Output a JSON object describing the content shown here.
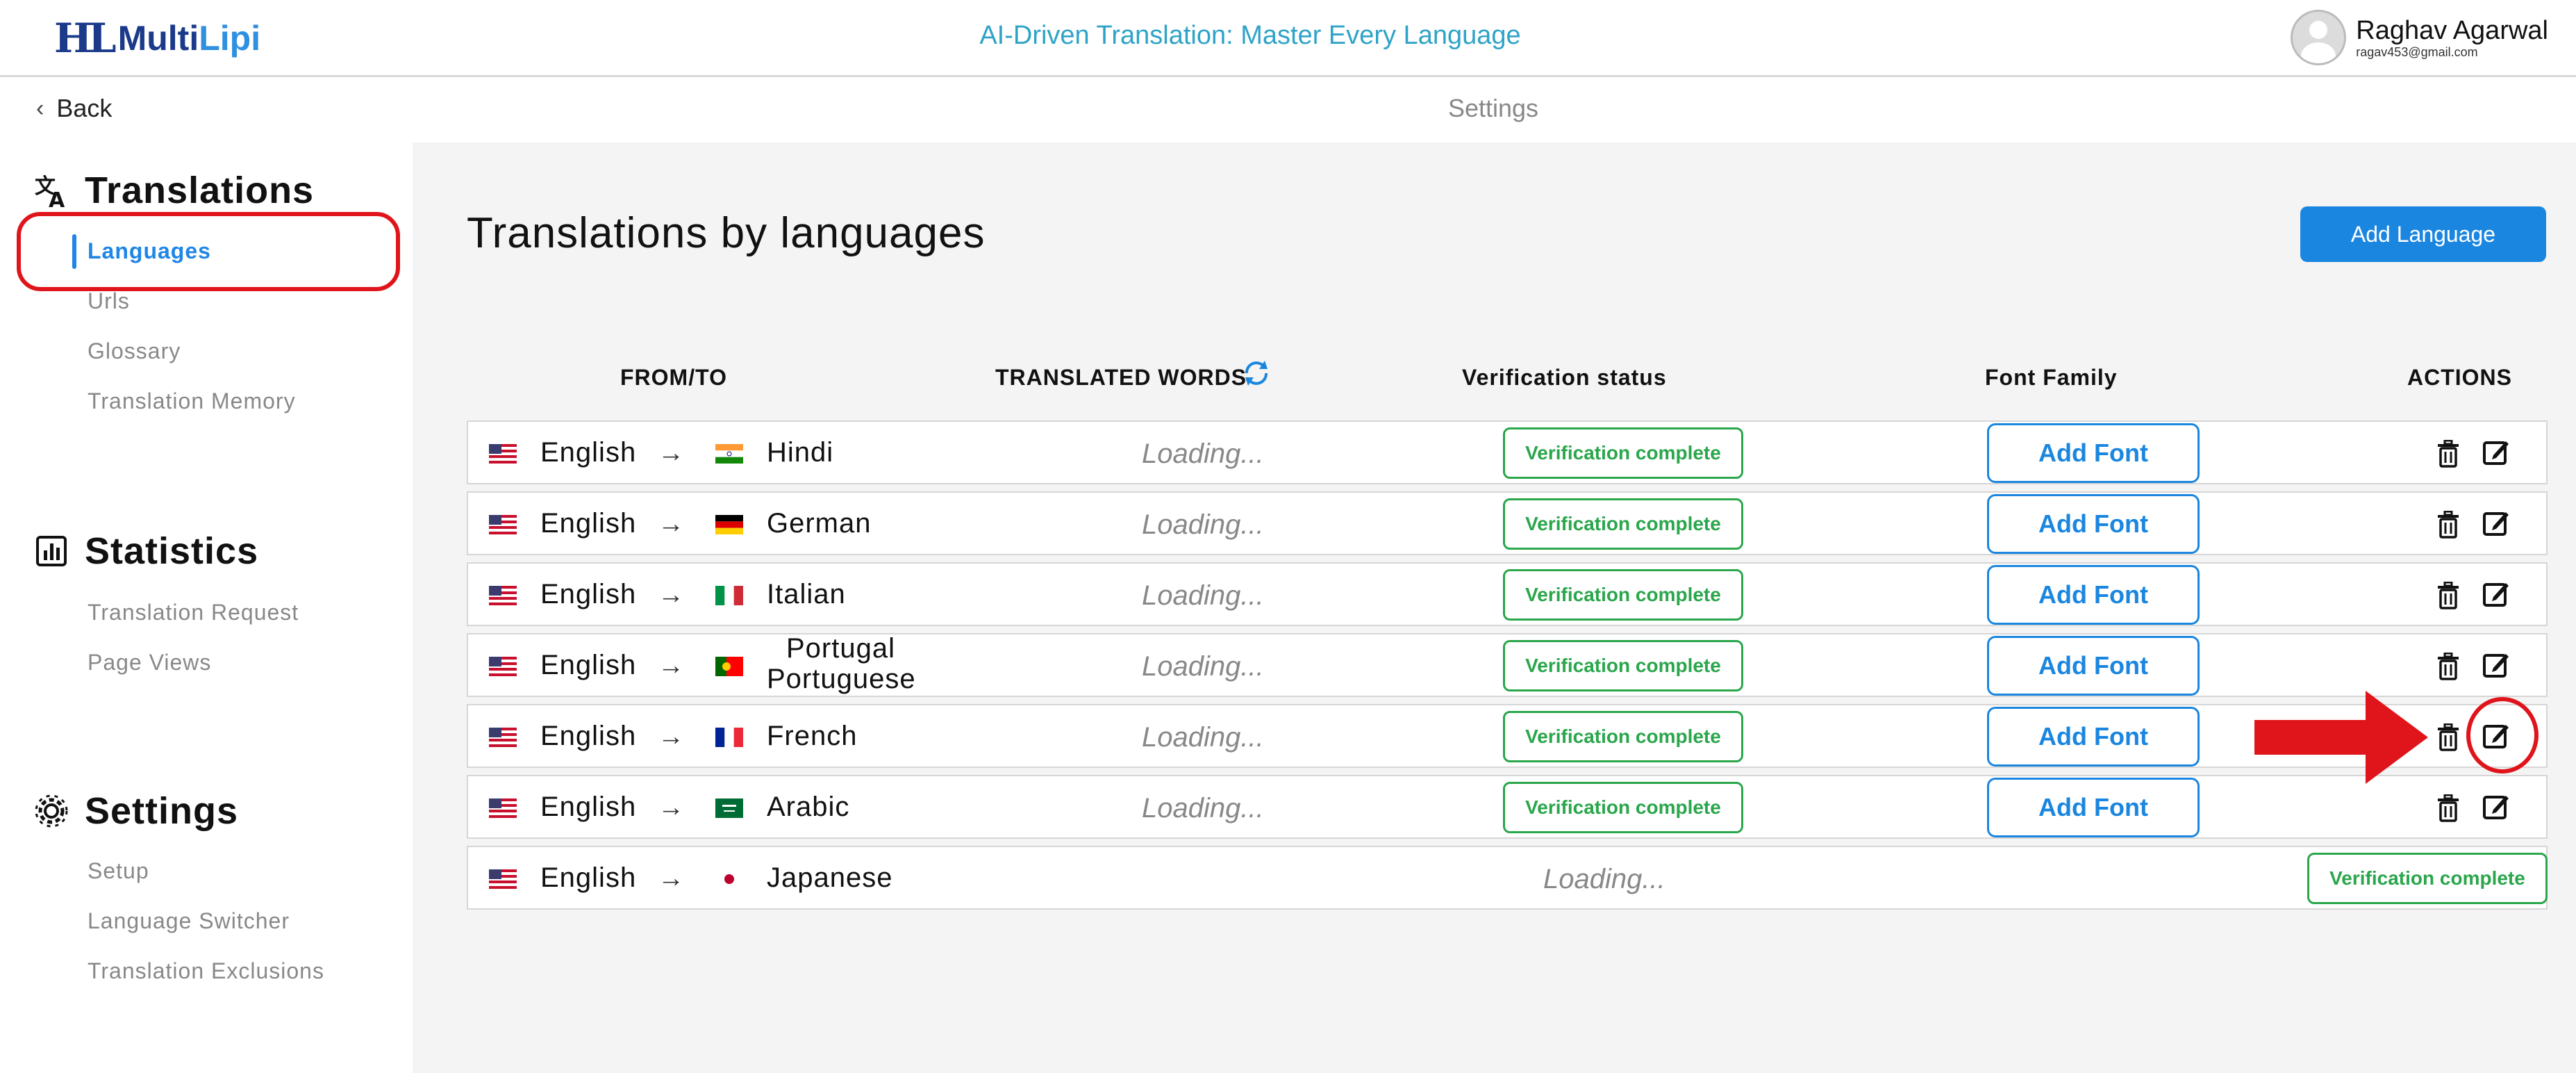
{
  "header": {
    "logo_mark": "HL",
    "logo_multi": "Multi",
    "logo_lipi": "Lipi",
    "tagline": "AI-Driven Translation: Master Every Language",
    "user_name": "Raghav Agarwal",
    "user_email": "ragav453@gmail.com"
  },
  "subbar": {
    "back_label": "Back",
    "page_label": "Settings"
  },
  "sidebar": {
    "translations": {
      "title": "Translations",
      "items": [
        "Languages",
        "Urls",
        "Glossary",
        "Translation Memory"
      ]
    },
    "statistics": {
      "title": "Statistics",
      "items": [
        "Translation Request",
        "Page Views"
      ]
    },
    "settings": {
      "title": "Settings",
      "items": [
        "Setup",
        "Language Switcher",
        "Translation Exclusions"
      ]
    }
  },
  "main": {
    "title": "Translations by languages",
    "add_language_label": "Add Language",
    "columns": {
      "from_to": "FROM/TO",
      "translated_words": "TRANSLATED WORDS",
      "verification_status": "Verification status",
      "font_family": "Font Family",
      "actions": "ACTIONS"
    },
    "rows": [
      {
        "from": "English",
        "to": "Hindi",
        "words": "Loading...",
        "status": "Verification complete",
        "font": "Add Font"
      },
      {
        "from": "English",
        "to": "German",
        "words": "Loading...",
        "status": "Verification complete",
        "font": "Add Font"
      },
      {
        "from": "English",
        "to": "Italian",
        "words": "Loading...",
        "status": "Verification complete",
        "font": "Add Font"
      },
      {
        "from": "English",
        "to_line1": "Portugal",
        "to_line2": "Portuguese",
        "words": "Loading...",
        "status": "Verification complete",
        "font": "Add Font"
      },
      {
        "from": "English",
        "to": "French",
        "words": "Loading...",
        "status": "Verification complete",
        "font": "Add Font"
      },
      {
        "from": "English",
        "to": "Arabic",
        "words": "Loading...",
        "status": "Verification complete",
        "font": "Add Font"
      },
      {
        "from": "English",
        "to": "Japanese",
        "words": "Loading...",
        "status": "Verification complete"
      }
    ],
    "arrow_glyph": "→"
  },
  "colors": {
    "accent": "#1a86e0",
    "success": "#2aa64b",
    "annotation": "#e0141b",
    "tagline": "#2ea3c8"
  },
  "icons": [
    "translate-icon",
    "bar-chart-icon",
    "settings-gear-icon",
    "trash-icon",
    "edit-icon",
    "refresh-icon",
    "chevron-left-icon"
  ]
}
